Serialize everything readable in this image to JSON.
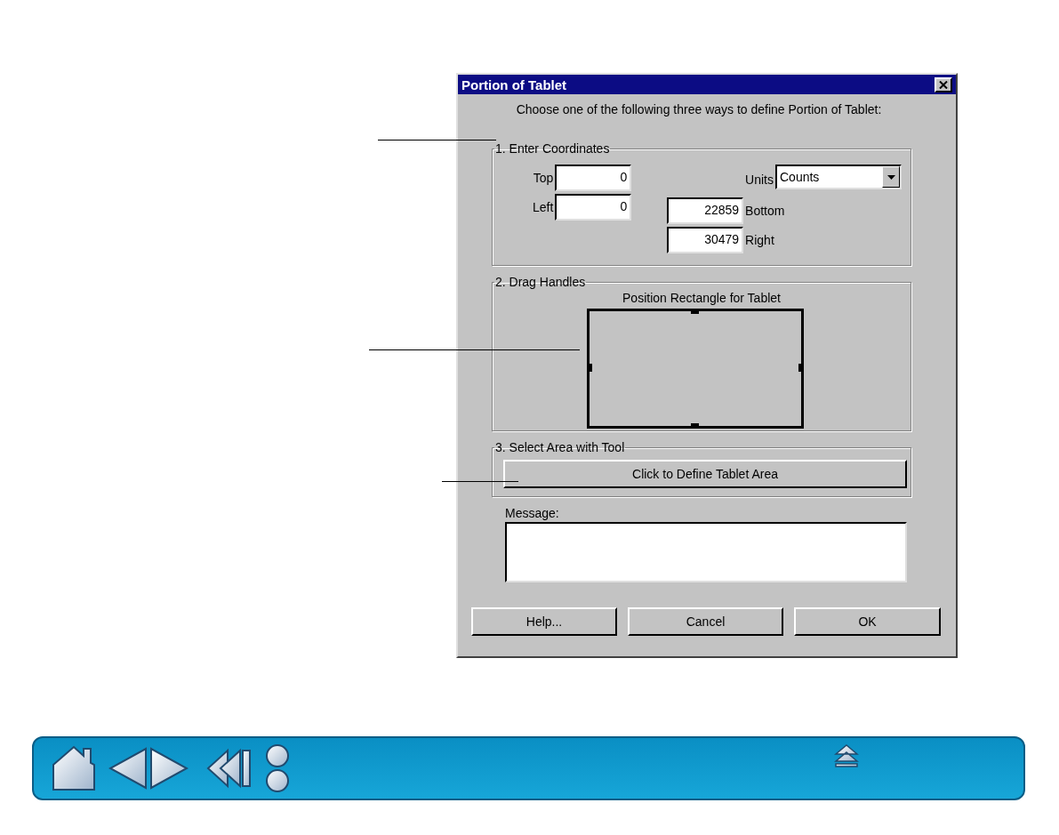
{
  "window": {
    "title": "Portion of Tablet"
  },
  "instruction": "Choose one of the following three ways to define Portion of Tablet:",
  "coordinates": {
    "title": "1. Enter Coordinates",
    "fields": [
      {
        "label": "Top",
        "value": "0"
      },
      {
        "label": "Left",
        "value": "0"
      }
    ],
    "units": {
      "label": "Units",
      "value": "Counts"
    },
    "extent_fields": [
      {
        "label": "Bottom",
        "value": "22859"
      },
      {
        "label": "Right",
        "value": "30479"
      }
    ]
  },
  "drag_handles": {
    "title": "2. Drag Handles",
    "caption": "Position Rectangle for Tablet"
  },
  "select_area": {
    "title": "3. Select Area with Tool",
    "button": "Click to Define Tablet Area"
  },
  "message": {
    "label": "Message:"
  },
  "buttons": [
    "Help...",
    "Cancel",
    "OK"
  ]
}
